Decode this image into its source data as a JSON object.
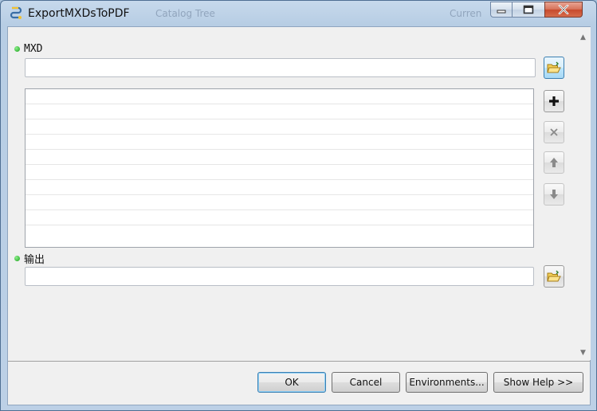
{
  "window": {
    "title": "ExportMXDsToPDF",
    "background_titles": [
      "Catalog Tree",
      "Curren"
    ]
  },
  "params": {
    "mxd": {
      "label": "MXD",
      "value": "",
      "browse_icon": "open-folder-icon",
      "required": true
    },
    "list": {
      "rows": [
        "",
        "",
        "",
        "",
        "",
        "",
        "",
        "",
        "",
        ""
      ]
    },
    "list_buttons": [
      {
        "name": "add-button",
        "icon": "plus-icon",
        "symbol": "+",
        "enabled": true
      },
      {
        "name": "remove-button",
        "icon": "x-icon",
        "symbol": "×",
        "enabled": false
      },
      {
        "name": "move-up-button",
        "icon": "arrow-up-icon",
        "symbol": "↑",
        "enabled": false
      },
      {
        "name": "move-down-button",
        "icon": "arrow-down-icon",
        "symbol": "↓",
        "enabled": false
      }
    ],
    "output": {
      "label": "输出",
      "value": "",
      "browse_icon": "open-folder-icon",
      "required": true
    }
  },
  "buttons": {
    "ok": "OK",
    "cancel": "Cancel",
    "environments": "Environments...",
    "show_help": "Show Help >>"
  },
  "colors": {
    "required_dot": "#18a018",
    "accent": "#3c7fb1",
    "close_button": "#c74a2c"
  }
}
